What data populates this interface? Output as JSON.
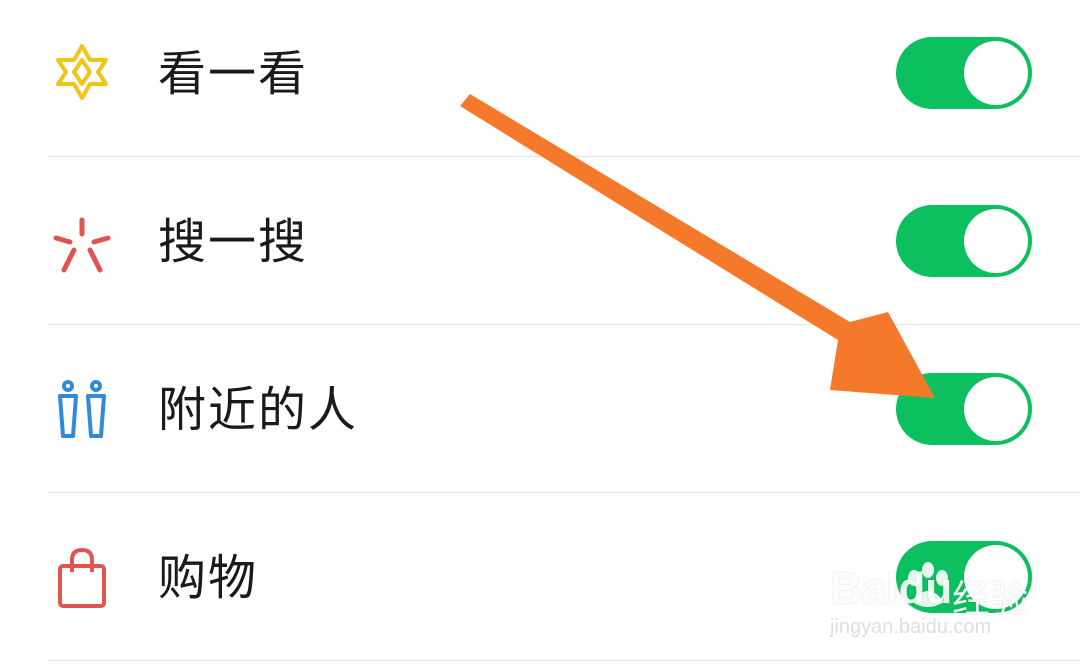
{
  "settings": {
    "items": [
      {
        "label": "看一看",
        "icon": "star-burst-icon",
        "enabled": true,
        "icon_color": "#f0c419"
      },
      {
        "label": "搜一搜",
        "icon": "search-spark-icon",
        "enabled": true,
        "icon_color": "#e0554d"
      },
      {
        "label": "附近的人",
        "icon": "people-nearby-icon",
        "enabled": true,
        "icon_color": "#2f8ad8"
      },
      {
        "label": "购物",
        "icon": "shopping-bag-icon",
        "enabled": true,
        "icon_color": "#e0554d"
      }
    ]
  },
  "colors": {
    "toggle_on": "#0cbf5f",
    "annotation_arrow": "#f5792a"
  },
  "watermark": {
    "brand": "Baidu",
    "brand_cn": "经验",
    "url": "jingyan.baidu.com"
  }
}
